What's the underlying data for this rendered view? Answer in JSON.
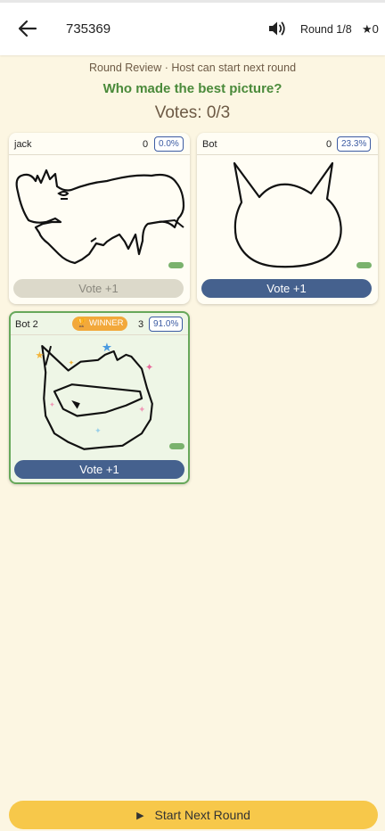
{
  "header": {
    "room_code": "735369",
    "round": "Round 1/8",
    "stars": "★0"
  },
  "review": {
    "subtitle": "Round Review · Host can start next round",
    "question": "Who made the best picture?",
    "votes": "Votes: 0/3"
  },
  "cards": [
    {
      "name": "jack",
      "score": "0",
      "percent": "0.0%",
      "vote_label": "Vote +1",
      "vote_enabled": false
    },
    {
      "name": "Bot",
      "score": "0",
      "percent": "23.3%",
      "vote_label": "Vote +1",
      "vote_enabled": true
    },
    {
      "name": "Bot 2",
      "score": "3",
      "percent": "91.0%",
      "vote_label": "Vote +1",
      "vote_enabled": true,
      "badge": "WINNER"
    }
  ],
  "footer": {
    "start_label": "Start Next Round"
  },
  "colors": {
    "background": "#fcf6e2",
    "accent_blue": "#45618e",
    "winner_green": "#67a85a",
    "start_yellow": "#f7c84a",
    "badge_orange": "#f2a83b"
  },
  "icons": [
    "back-arrow-icon",
    "speaker-icon",
    "play-icon",
    "trophy-icon",
    "star-icon",
    "sparkle-icon"
  ]
}
